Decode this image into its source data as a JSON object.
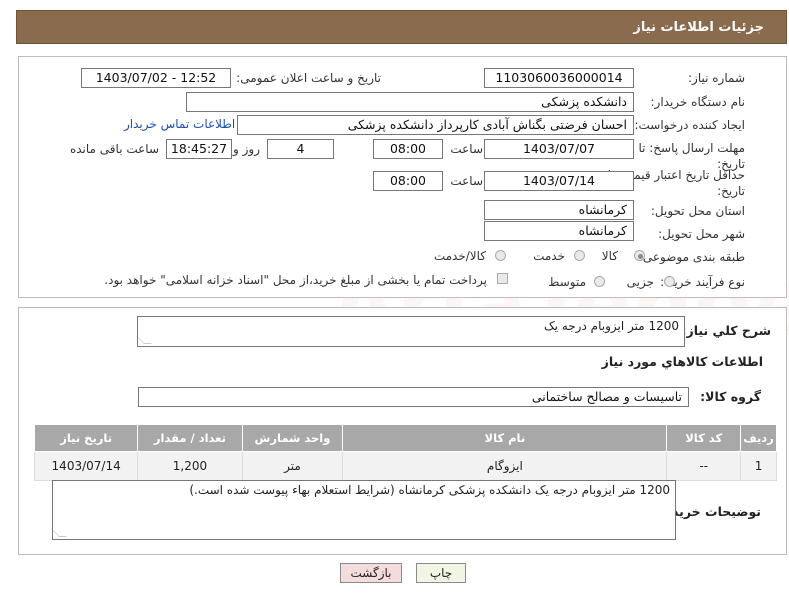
{
  "header": {
    "title": "جزئیات اطلاعات نیاز"
  },
  "labels": {
    "need_number": "شماره نیاز:",
    "announce_datetime": "تاریخ و ساعت اعلان عمومی:",
    "buyer_org": "نام دستگاه خریدار:",
    "creator": "ایجاد کننده درخواست:",
    "contact_link": "اطلاعات تماس خریدار",
    "reply_deadline": "مهلت ارسال پاسخ: تا تاریخ:",
    "time": "ساعت",
    "day_and": "روز و",
    "remaining_time": "ساعت باقی مانده",
    "price_validity": "حداقل تاریخ اعتبار قیمت: تا تاریخ:",
    "province": "استان محل تحویل:",
    "city": "شهر محل تحویل:",
    "category": "طبقه بندی موضوعی:",
    "process_type": "نوع فرآیند خرید :",
    "need_summary": "شرح كلي نياز:",
    "goods_info": "اطلاعات كالاهاي مورد نياز",
    "goods_group": "گروه كالا:",
    "buyer_notes": "توضیحات خریدار:"
  },
  "fields": {
    "need_number": "1103060036000014",
    "announce_datetime": "1403/07/02 - 12:52",
    "buyer_org": "دانشکده پزشکی",
    "creator": "احسان فرضتی بگناش آبادی کارپرداز دانشکده پزشکی",
    "reply_date": "1403/07/07",
    "reply_time": "08:00",
    "days_left": "4",
    "hours_left": "18:45:27",
    "validity_date": "1403/07/14",
    "validity_time": "08:00",
    "province": "کرمانشاه",
    "city": "کرمانشاه",
    "need_summary": "1200 متر ایزوبام درجه یک",
    "goods_group": "تاسیسات و مصالح ساختمانی",
    "buyer_notes": "1200 متر ایزوبام درجه یک  دانشکده پزشکی کرمانشاه (شرایط استعلام بهاء پیوست شده است.)"
  },
  "category_options": [
    {
      "label": "کالا",
      "selected": true
    },
    {
      "label": "خدمت",
      "selected": false
    },
    {
      "label": "کالا/خدمت",
      "selected": false
    }
  ],
  "process_options": [
    {
      "label": "جزیی",
      "selected": false
    },
    {
      "label": "متوسط",
      "selected": false
    }
  ],
  "payment_note": "پرداخت تمام یا بخشی از مبلغ خرید،از محل \"اسناد خزانه اسلامی\" خواهد بود.",
  "table": {
    "headers": [
      "ردیف",
      "کد کالا",
      "نام کالا",
      "واحد شمارش",
      "تعداد / مقدار",
      "تاریخ نیاز"
    ],
    "rows": [
      [
        "1",
        "--",
        "ایزوگام",
        "متر",
        "1,200",
        "1403/07/14"
      ]
    ]
  },
  "buttons": {
    "print": "چاپ",
    "back": "بازگشت"
  },
  "watermark": "AriaTender.neT",
  "colors": {
    "header": "#8a6b4d",
    "table_header": "#a8a8a8",
    "back_button": "#f5dcdc",
    "print_button": "#f0f5e4"
  }
}
